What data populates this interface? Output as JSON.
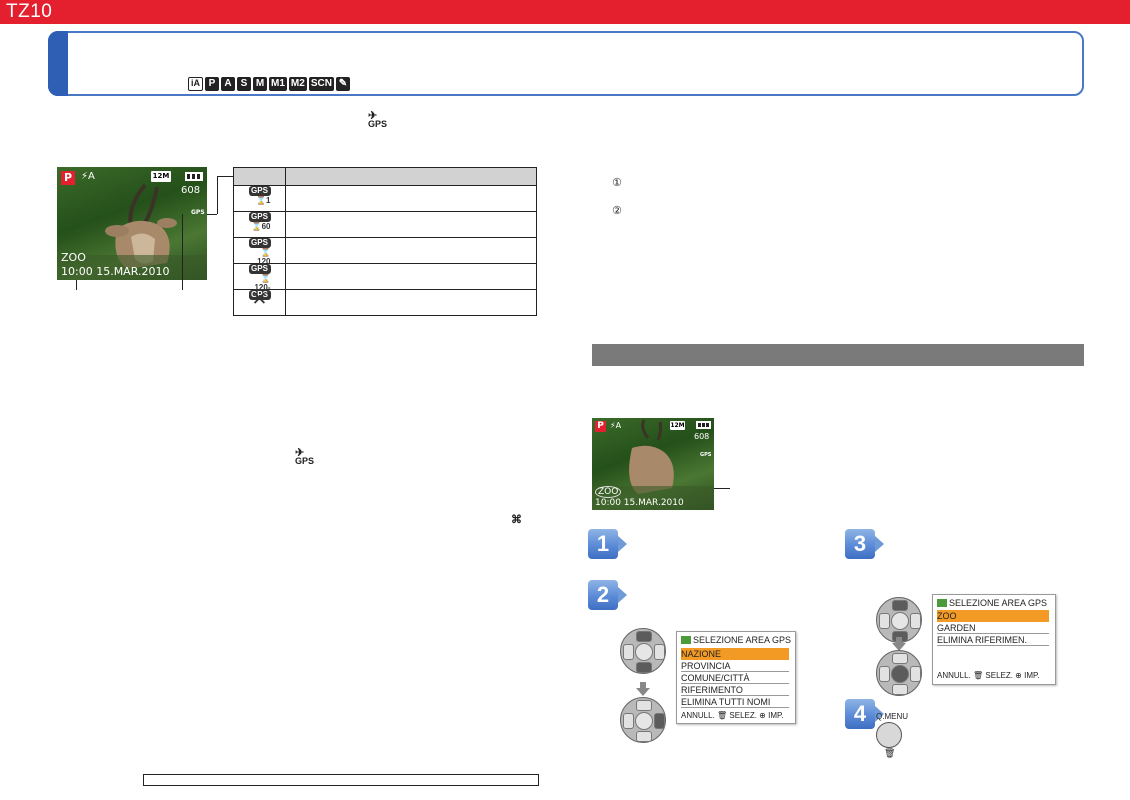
{
  "header": {
    "model": "TZ10"
  },
  "modes": [
    "iA",
    "P",
    "A",
    "S",
    "M",
    "M1",
    "M2",
    "SCN",
    "✎"
  ],
  "gps_icon": {
    "label": "GPS"
  },
  "screen1": {
    "mode": "P",
    "flash": "⚡A",
    "resolution": "12M",
    "shots": "608",
    "gps": "GPS",
    "place": "ZOO",
    "datetime": "10:00  15.MAR.2010"
  },
  "gps_table": [
    {
      "icon": "GPS",
      "sub": "⌛1"
    },
    {
      "icon": "GPS",
      "sub": "⌛60"
    },
    {
      "icon": "GPS",
      "sub": "⌛120"
    },
    {
      "icon": "GPS",
      "sub": "⌛120-"
    },
    {
      "icon": "GPS",
      "sub": ""
    }
  ],
  "circled": [
    "①",
    "②"
  ],
  "screen2": {
    "mode": "P",
    "flash": "⚡A",
    "resolution": "12M",
    "shots": "608",
    "gps": "GPS",
    "place": "ZOO",
    "datetime": "10:00  15.MAR.2010"
  },
  "steps": [
    "1",
    "2",
    "3",
    "4"
  ],
  "menu1": {
    "title": "SELEZIONE AREA GPS",
    "items": [
      "NAZIONE",
      "PROVINCIA",
      "COMUNE/CITTÀ",
      "RIFERIMENTO",
      "ELIMINA TUTTI NOMI"
    ],
    "footer": "ANNULL. 🗑 SELEZ. ⊕ IMP."
  },
  "menu2": {
    "title": "SELEZIONE AREA GPS",
    "items": [
      "ZOO",
      "GARDEN",
      "ELIMINA RIFERIMEN."
    ],
    "footer": "ANNULL. 🗑 SELEZ. ⊕ IMP."
  },
  "qmenu": {
    "label": "Q.MENU",
    "trash": "🗑"
  },
  "colors": {
    "brand_red": "#e4202e",
    "blue": "#2e5fb4",
    "highlight": "#f39a24"
  }
}
